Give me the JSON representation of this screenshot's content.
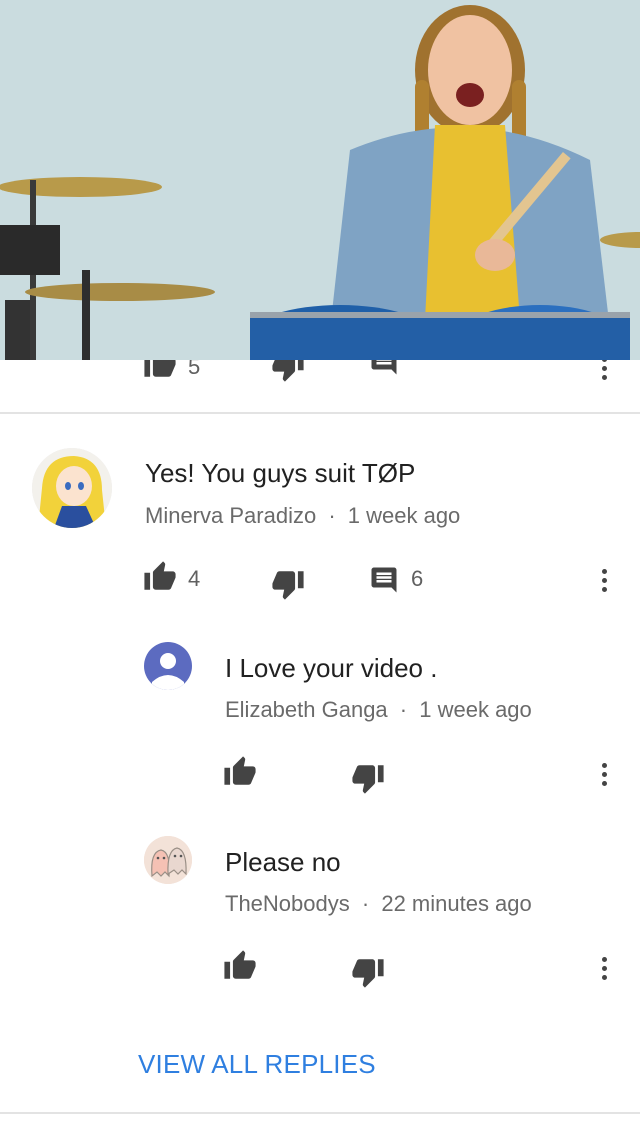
{
  "video": {
    "description_icon": "video-frame"
  },
  "previous_comment": {
    "like_count": "5"
  },
  "comments": [
    {
      "text": "Yes! You guys suit TØP",
      "author": "Minerva Paradizo",
      "time": "1 week ago",
      "likes": "4",
      "reply_count": "6"
    }
  ],
  "replies": [
    {
      "text": "I Love your video .",
      "author": "Elizabeth Ganga",
      "time": "1 week ago"
    },
    {
      "text": "Please no",
      "author": "TheNobodys",
      "time": "22 minutes ago"
    }
  ],
  "separator": "·",
  "view_all_label": "VIEW ALL REPLIES",
  "colors": {
    "link": "#2f7fe0",
    "text": "#212121",
    "meta": "#6a6a6a",
    "icon": "#444444",
    "default_avatar": "#5c6bc0"
  }
}
